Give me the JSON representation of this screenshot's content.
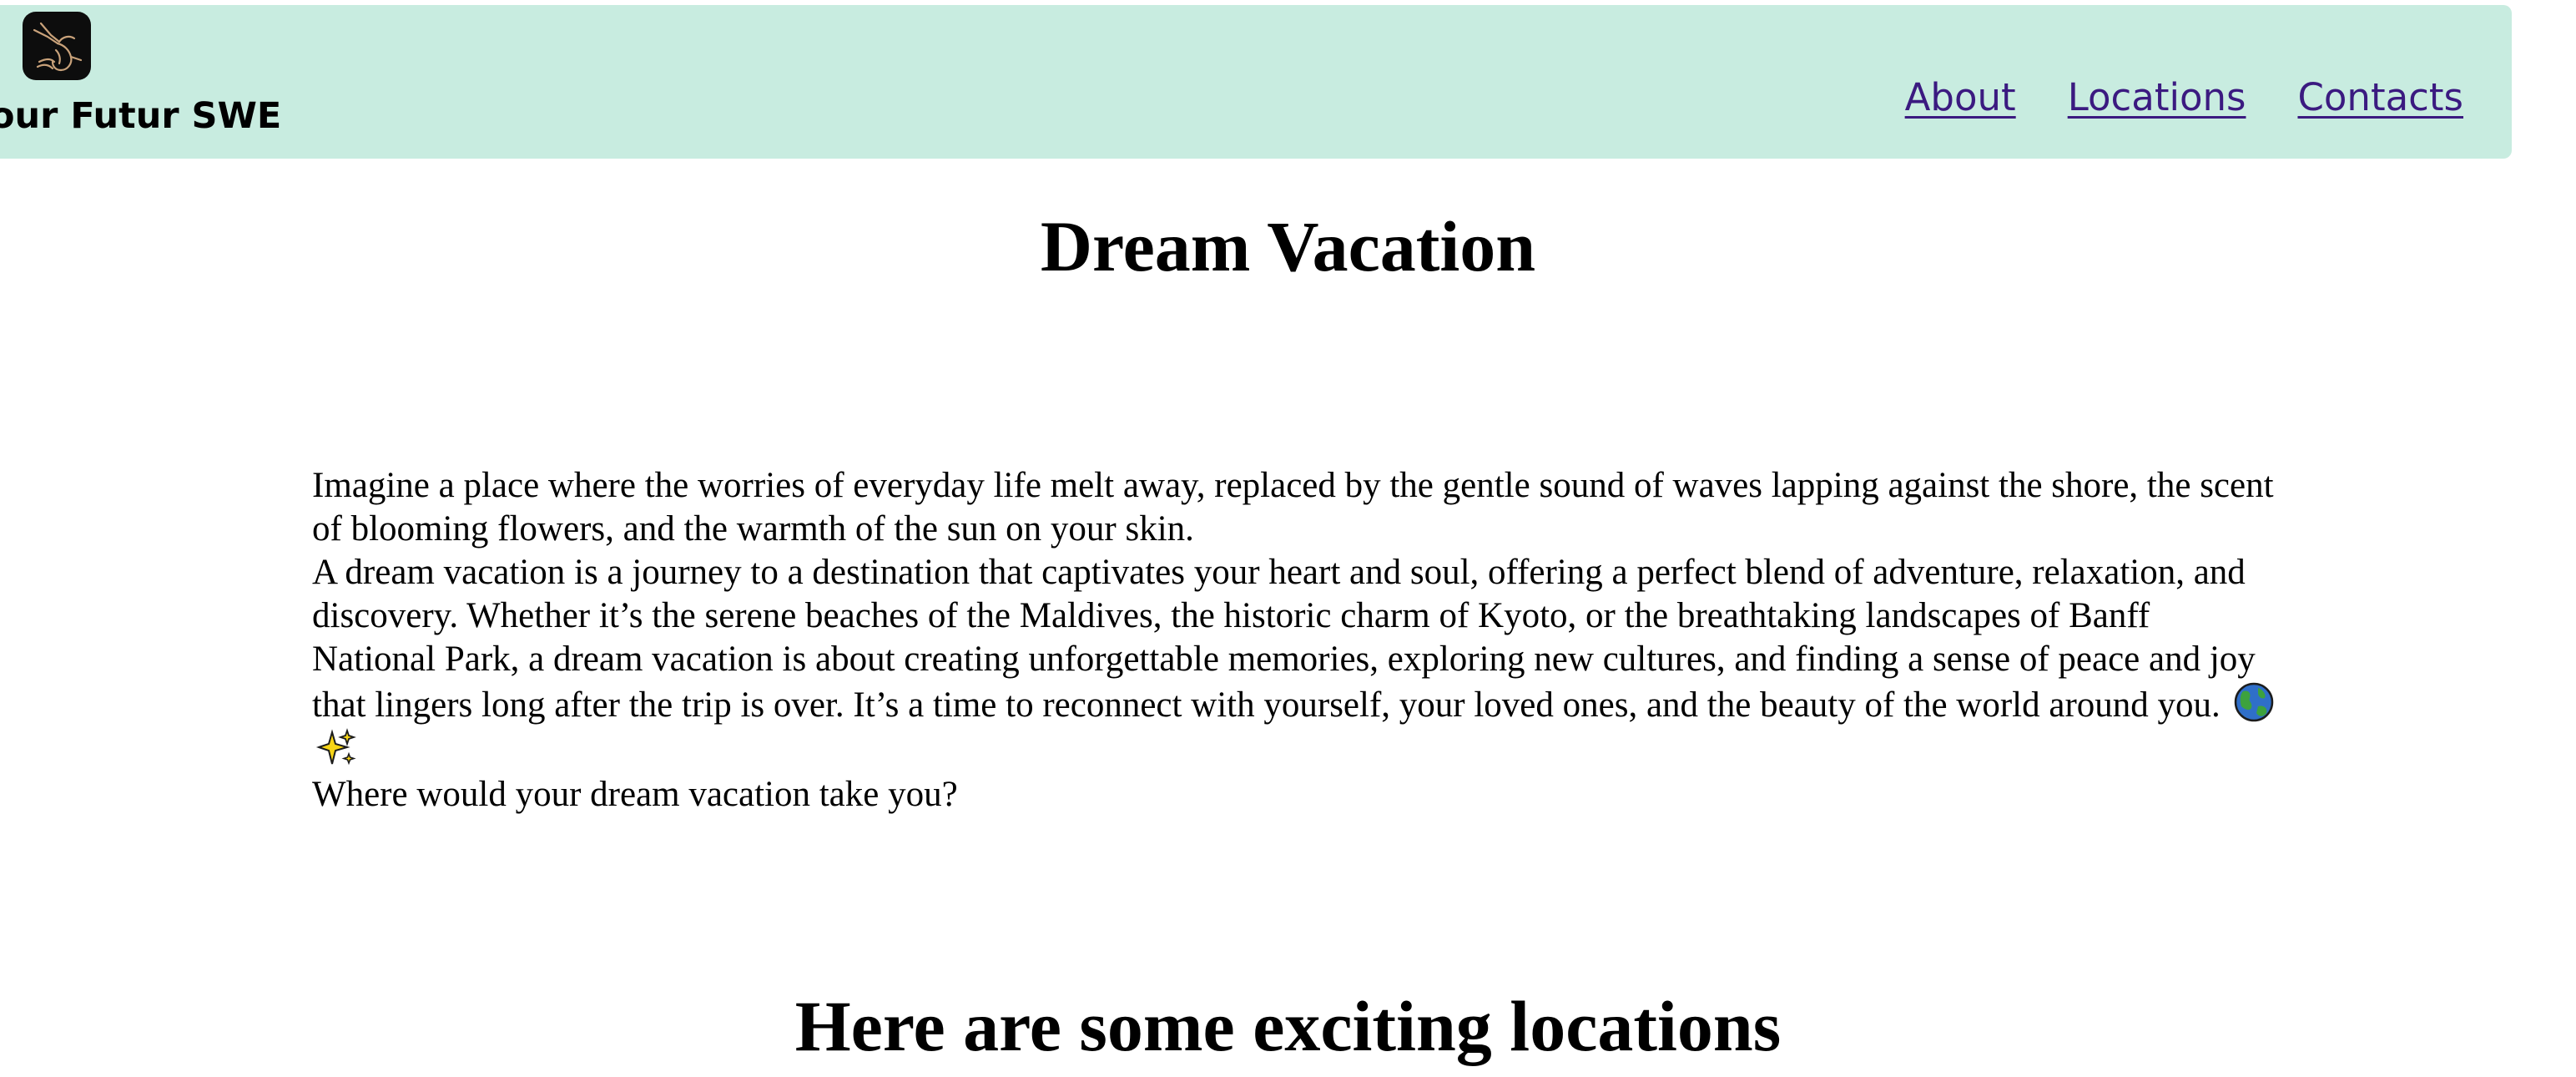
{
  "header": {
    "brand": "our Futur SWE",
    "logo_icon": "hummingbird-icon",
    "background": "#c8ece0",
    "nav": [
      {
        "label": "About"
      },
      {
        "label": "Locations"
      },
      {
        "label": "Contacts"
      }
    ],
    "link_color": "#3b1a80"
  },
  "main": {
    "title": "Dream Vacation",
    "paragraphs": [
      "Imagine a place where the worries of everyday life melt away, replaced by the gentle sound of waves lapping against the shore, the scent of blooming flowers, and the warmth of the sun on your skin.",
      "A dream vacation is a journey to a destination that captivates your heart and soul, offering a perfect blend of adventure, relaxation, and discovery. Whether it’s the serene beaches of the Maldives, the historic charm of Kyoto, or the breathtaking landscapes of Banff National Park, a dream vacation is about creating unforgettable memories, exploring new cultures, and finding a sense of peace and joy that lingers long after the trip is over. It’s a time to reconnect with yourself, your loved ones, and the beauty of the world around you.",
      "Where would your dream vacation take you?"
    ],
    "emoji_icons": [
      "globe-icon",
      "sparkles-icon"
    ],
    "locations_heading": "Here are some exciting locations"
  }
}
